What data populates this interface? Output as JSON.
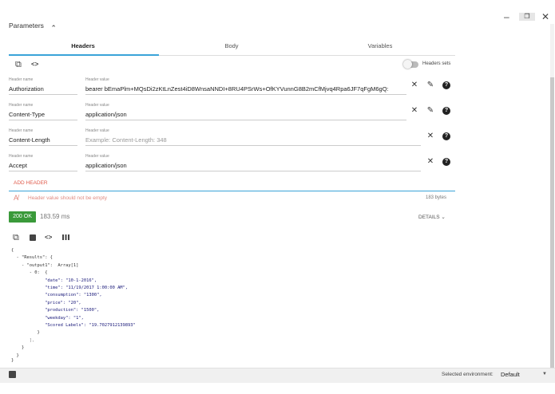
{
  "window": {
    "minimize_icon": "–",
    "restore_icon": "❐",
    "close_icon": "✕"
  },
  "parameters": {
    "title": "Parameters",
    "chevron": "⌃"
  },
  "tabs": [
    {
      "label": "Headers"
    },
    {
      "label": "Body"
    },
    {
      "label": "Variables"
    }
  ],
  "toolbar": {
    "copy_icon": "⧉",
    "code_icon": "<>",
    "headers_sets_label": "Headers sets"
  },
  "headers": [
    {
      "name_label": "Header name",
      "name": "Authorization",
      "value_label": "Header value",
      "value": "bearer bEmaPlm+MQsDi2zKtLnZest4iD8WnsaNNDI+8RU4PSrWs+OfKYVunnG8B2mCfMjvq4Rpa6JF7qFgM6gQ:"
    },
    {
      "name_label": "Header name",
      "name": "Content-Type",
      "value_label": "Header value",
      "value": "application/json"
    },
    {
      "name_label": "Header name",
      "name": "Content-Length",
      "value_label": "Header value",
      "placeholder": "Example: Content-Length: 348"
    },
    {
      "name_label": "Header name",
      "name": "Accept",
      "value_label": "Header value",
      "value": "application/json"
    }
  ],
  "add_header_label": "ADD HEADER",
  "warning": "Header value should not be empty",
  "response": {
    "size": "183 bytes",
    "status": "200 OK",
    "time": "183.59 ms",
    "details_label": "DETAILS"
  },
  "json_lines": [
    "{",
    "  - \"Results\": {",
    "    - \"output1\":  Array[1]",
    "       - 0:  {",
    "             \"date\": \"10-1-2016\",",
    "             \"time\": \"11/19/2017 1:00:00 AM\",",
    "             \"consumption\": \"1300\",",
    "             \"price\": \"20\",",
    "             \"production\": \"1500\",",
    "             \"weekday\": \"1\",",
    "             \"Scored Labels\": \"19.7027912139893\"",
    "          }",
    "       ],",
    "    }",
    "  }",
    "}"
  ],
  "environment": {
    "label": "Selected environment:",
    "value": "Default"
  },
  "colors": {
    "accent": "#3aa3d8",
    "status_ok": "#3a9a3a",
    "add_header": "#e05a4a"
  }
}
